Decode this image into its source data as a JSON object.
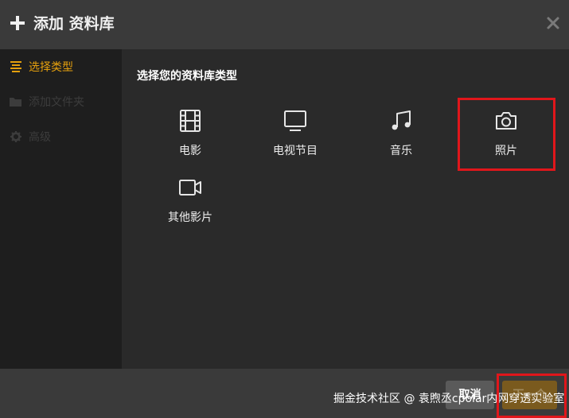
{
  "header": {
    "title": "添加 资料库",
    "plus_icon": "plus-icon",
    "close_icon": "close-icon"
  },
  "sidebar": {
    "items": [
      {
        "label": "选择类型",
        "icon": "list-icon",
        "state": "active"
      },
      {
        "label": "添加文件夹",
        "icon": "folder-icon",
        "state": "disabled"
      },
      {
        "label": "高级",
        "icon": "gear-icon",
        "state": "disabled"
      }
    ]
  },
  "main": {
    "heading": "选择您的资料库类型",
    "types": [
      {
        "label": "电影",
        "icon": "film-icon"
      },
      {
        "label": "电视节目",
        "icon": "tv-icon"
      },
      {
        "label": "音乐",
        "icon": "music-note-icon"
      },
      {
        "label": "照片",
        "icon": "camera-icon",
        "highlighted": true
      },
      {
        "label": "其他影片",
        "icon": "video-camera-icon"
      }
    ]
  },
  "footer": {
    "cancel_label": "取消",
    "next_label": "下一个",
    "watermark": "掘金技术社区 @ 袁煦丞cpolar内网穿透实验室"
  },
  "colors": {
    "accent": "#e5a00d",
    "highlight_box": "#e0161b",
    "header_bg": "#3a3a3a",
    "sidebar_bg": "#1e1e1e",
    "content_bg": "#2a2a2a"
  }
}
